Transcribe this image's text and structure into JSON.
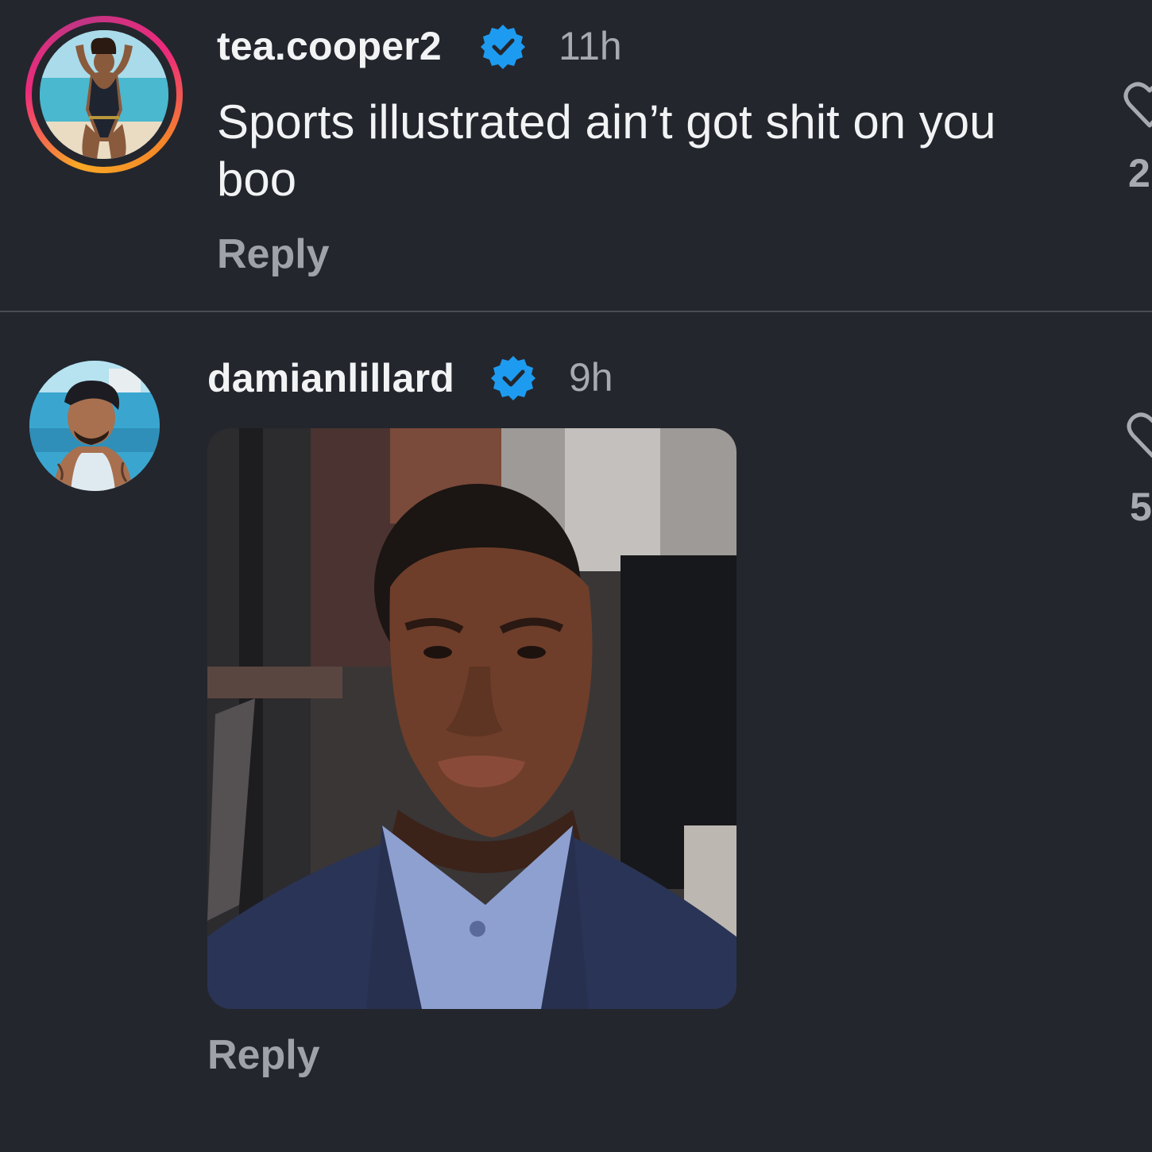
{
  "comments": [
    {
      "username": "tea.cooper2",
      "verified": true,
      "timestamp": "11h",
      "text": "Sports illustrated ain’t got shit on you boo",
      "reply_label": "Reply",
      "like_count": "2",
      "avatar_icon": "avatar-woman-swimsuit",
      "story_ring": true
    },
    {
      "username": "damianlillard",
      "verified": true,
      "timestamp": "9h",
      "media": "gif-reaction-man-suit",
      "reply_label": "Reply",
      "like_count": "5",
      "avatar_icon": "avatar-man-cap"
    }
  ],
  "colors": {
    "background": "#24262d",
    "verified_badge": "#1d9bf0",
    "secondary_text": "#a7aab1"
  }
}
